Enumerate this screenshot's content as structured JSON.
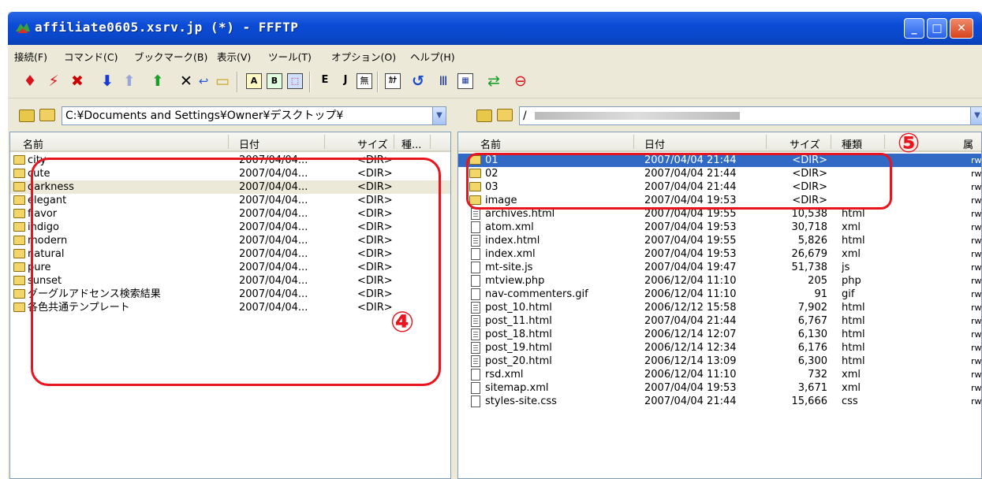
{
  "window": {
    "title": "affiliate0605.xsrv.jp (*) - FFFTP",
    "buttons": {
      "minimize": "_",
      "maximize": "□",
      "close": "✕"
    }
  },
  "menu": [
    "接続(F)",
    "コマンド(C)",
    "ブックマーク(B)",
    "表示(V)",
    "ツール(T)",
    "オプション(O)",
    "ヘルプ(H)"
  ],
  "toolbar": {
    "icons": [
      "connect-icon",
      "quick-connect-icon",
      "disconnect-icon",
      "download-icon",
      "upload-icon",
      "upload-mirror-icon",
      "delete-icon",
      "rename-icon",
      "mkdir-icon",
      "ascii-mode-icon",
      "binary-mode-icon",
      "auto-mode-icon",
      "kanji-euc-icon",
      "kanji-jis-icon",
      "kanji-none-icon",
      "kana-convert-icon",
      "refresh-icon",
      "list-icon",
      "detail-icon",
      "sync-icon",
      "stop-icon"
    ],
    "labels": {
      "ascii": "A",
      "binary": "B",
      "euc": "E",
      "jis": "J",
      "none": "無",
      "kana": "ｶﾅ"
    }
  },
  "local": {
    "path": "C:¥Documents and Settings¥Owner¥デスクトップ¥",
    "headers": {
      "name": "名前",
      "date": "日付",
      "size": "サイズ",
      "type": "種..."
    },
    "rows": [
      {
        "name": "city",
        "date": "2007/04/04...",
        "size": "<DIR>"
      },
      {
        "name": "cute",
        "date": "2007/04/04...",
        "size": "<DIR>"
      },
      {
        "name": "darkness",
        "date": "2007/04/04...",
        "size": "<DIR>"
      },
      {
        "name": "elegant",
        "date": "2007/04/04...",
        "size": "<DIR>"
      },
      {
        "name": "flavor",
        "date": "2007/04/04...",
        "size": "<DIR>"
      },
      {
        "name": "indigo",
        "date": "2007/04/04...",
        "size": "<DIR>"
      },
      {
        "name": "modern",
        "date": "2007/04/04...",
        "size": "<DIR>"
      },
      {
        "name": "natural",
        "date": "2007/04/04...",
        "size": "<DIR>"
      },
      {
        "name": "pure",
        "date": "2007/04/04...",
        "size": "<DIR>"
      },
      {
        "name": "sunset",
        "date": "2007/04/04...",
        "size": "<DIR>"
      },
      {
        "name": "グーグルアドセンス検索結果",
        "date": "2007/04/04...",
        "size": "<DIR>"
      },
      {
        "name": "各色共通テンプレート",
        "date": "2007/04/04...",
        "size": "<DIR>"
      }
    ]
  },
  "remote": {
    "path": "/",
    "headers": {
      "name": "名前",
      "date": "日付",
      "size": "サイズ",
      "type": "種類",
      "attr": "属"
    },
    "rows": [
      {
        "name": "01",
        "date": "2007/04/04 21:44",
        "size": "<DIR>",
        "type": "",
        "attr": "rw",
        "kind": "dir"
      },
      {
        "name": "02",
        "date": "2007/04/04 21:44",
        "size": "<DIR>",
        "type": "",
        "attr": "rw",
        "kind": "dir"
      },
      {
        "name": "03",
        "date": "2007/04/04 21:44",
        "size": "<DIR>",
        "type": "",
        "attr": "rw",
        "kind": "dir"
      },
      {
        "name": "image",
        "date": "2007/04/04 19:53",
        "size": "<DIR>",
        "type": "",
        "attr": "rw",
        "kind": "dir"
      },
      {
        "name": "archives.html",
        "date": "2007/04/04 19:55",
        "size": "10,538",
        "type": "html",
        "attr": "rw",
        "kind": "html"
      },
      {
        "name": "atom.xml",
        "date": "2007/04/04 19:53",
        "size": "30,718",
        "type": "xml",
        "attr": "rw",
        "kind": "file"
      },
      {
        "name": "index.html",
        "date": "2007/04/04 19:55",
        "size": "5,826",
        "type": "html",
        "attr": "rw",
        "kind": "html"
      },
      {
        "name": "index.xml",
        "date": "2007/04/04 19:53",
        "size": "26,679",
        "type": "xml",
        "attr": "rw",
        "kind": "file"
      },
      {
        "name": "mt-site.js",
        "date": "2007/04/04 19:47",
        "size": "51,738",
        "type": "js",
        "attr": "rw",
        "kind": "file"
      },
      {
        "name": "mtview.php",
        "date": "2006/12/04 11:10",
        "size": "205",
        "type": "php",
        "attr": "rw",
        "kind": "file"
      },
      {
        "name": "nav-commenters.gif",
        "date": "2006/12/04 11:10",
        "size": "91",
        "type": "gif",
        "attr": "rw",
        "kind": "file"
      },
      {
        "name": "post_10.html",
        "date": "2006/12/12 15:58",
        "size": "7,902",
        "type": "html",
        "attr": "rw",
        "kind": "html"
      },
      {
        "name": "post_11.html",
        "date": "2007/04/04 21:44",
        "size": "6,767",
        "type": "html",
        "attr": "rw",
        "kind": "html"
      },
      {
        "name": "post_18.html",
        "date": "2006/12/14 12:07",
        "size": "6,130",
        "type": "html",
        "attr": "rw",
        "kind": "html"
      },
      {
        "name": "post_19.html",
        "date": "2006/12/14 12:34",
        "size": "6,176",
        "type": "html",
        "attr": "rw",
        "kind": "html"
      },
      {
        "name": "post_20.html",
        "date": "2006/12/14 13:09",
        "size": "6,300",
        "type": "html",
        "attr": "rw",
        "kind": "html"
      },
      {
        "name": "rsd.xml",
        "date": "2006/12/04 11:10",
        "size": "732",
        "type": "xml",
        "attr": "rw",
        "kind": "file"
      },
      {
        "name": "sitemap.xml",
        "date": "2007/04/04 19:53",
        "size": "3,671",
        "type": "xml",
        "attr": "rw",
        "kind": "file"
      },
      {
        "name": "styles-site.css",
        "date": "2007/04/04 21:44",
        "size": "15,666",
        "type": "css",
        "attr": "rw",
        "kind": "file"
      }
    ]
  },
  "annotations": {
    "four": "④",
    "five": "⑤"
  },
  "colors": {
    "selection": "#316ac5",
    "annotation": "#e8141e",
    "titlebar": "#0a46c8"
  }
}
